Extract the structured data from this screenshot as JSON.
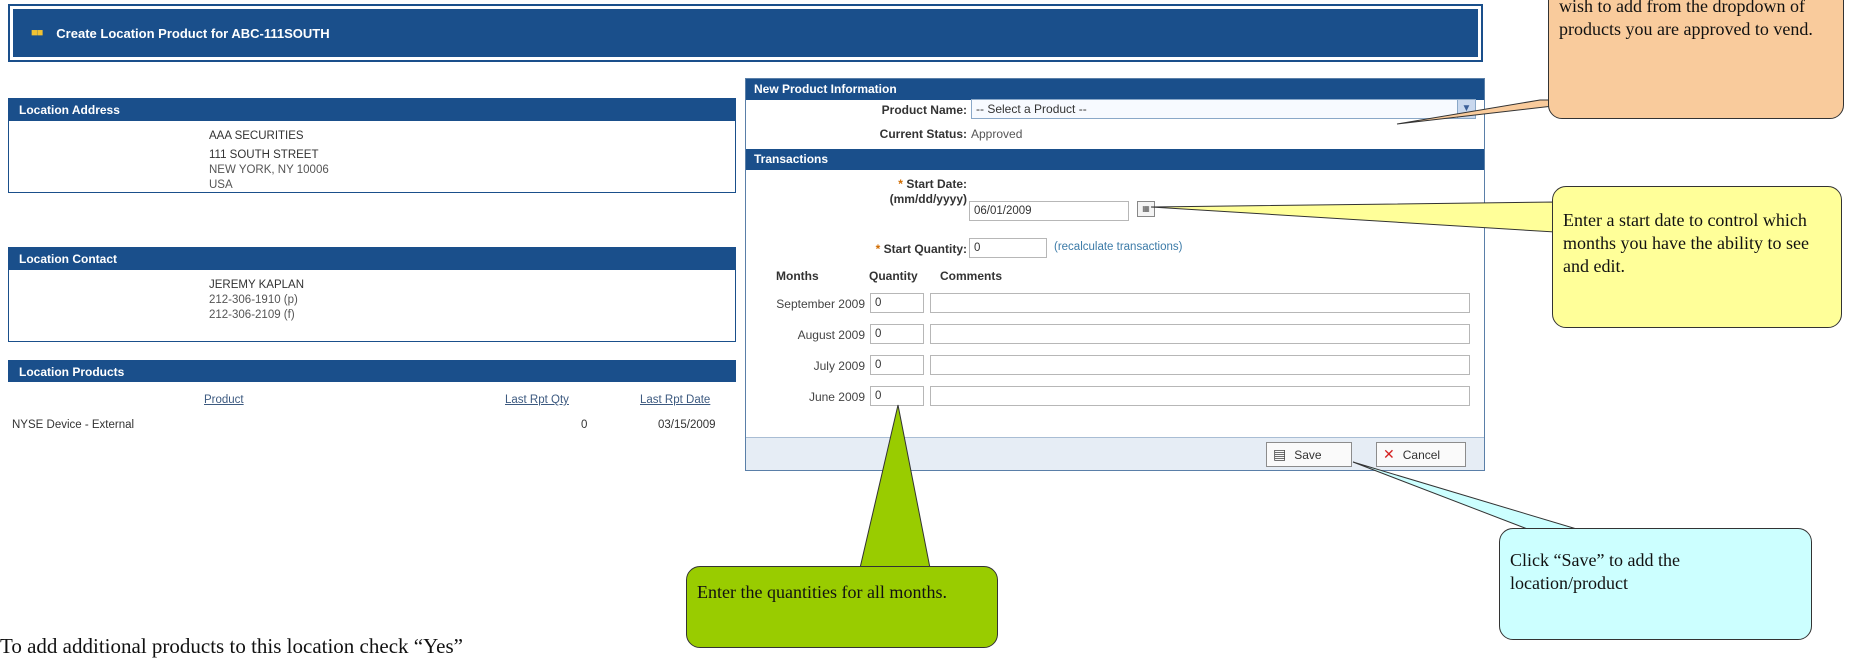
{
  "header": {
    "title": "Create Location Product for ABC-111SOUTH"
  },
  "location_address": {
    "title": "Location Address",
    "name": "AAA SECURITIES",
    "street": "111 SOUTH STREET",
    "city": "NEW YORK, NY 10006",
    "country": "USA"
  },
  "location_contact": {
    "title": "Location Contact",
    "name": "JEREMY KAPLAN",
    "phone": "212-306-1910 (p)",
    "fax": "212-306-2109 (f)"
  },
  "location_products": {
    "title": "Location Products",
    "columns": {
      "product": "Product",
      "last_rpt_qty": "Last Rpt Qty",
      "last_rpt_date": "Last Rpt Date"
    },
    "rows": [
      {
        "product": "NYSE Device - External",
        "qty": "0",
        "date": "03/15/2009"
      }
    ]
  },
  "new_product": {
    "title": "New Product Information",
    "product_name_label": "Product Name:",
    "product_select_value": "-- Select a Product --",
    "current_status_label": "Current Status:",
    "current_status_value": "Approved"
  },
  "transactions": {
    "title": "Transactions",
    "start_date_label": "Start Date:",
    "date_format_label": "(mm/dd/yyyy)",
    "start_date_value": "06/01/2009",
    "start_quantity_label": "Start Quantity:",
    "start_quantity_value": "0",
    "recalculate_link": "(recalculate transactions)",
    "columns": {
      "months": "Months",
      "quantity": "Quantity",
      "comments": "Comments"
    },
    "rows": [
      {
        "month": "September 2009",
        "quantity": "0",
        "comment": ""
      },
      {
        "month": "August 2009",
        "quantity": "0",
        "comment": ""
      },
      {
        "month": "July 2009",
        "quantity": "0",
        "comment": ""
      },
      {
        "month": "June 2009",
        "quantity": "0",
        "comment": ""
      }
    ]
  },
  "buttons": {
    "save": "Save",
    "cancel": "Cancel"
  },
  "callouts": {
    "product": "wish to add from the dropdown of products you are approved to vend.",
    "start_date": "Enter a start date to control which months you have the ability to see and edit.",
    "quantities": "Enter the quantities for all months.",
    "save": "Click “Save” to add the location/product"
  },
  "footer_text": "To add additional products to this location check “Yes”",
  "colors": {
    "header_blue": "#1a4f8b",
    "callout_orange": "#f9cb9c",
    "callout_yellow": "#ffff99",
    "callout_green": "#99cc00",
    "callout_cyan": "#ccffff"
  }
}
